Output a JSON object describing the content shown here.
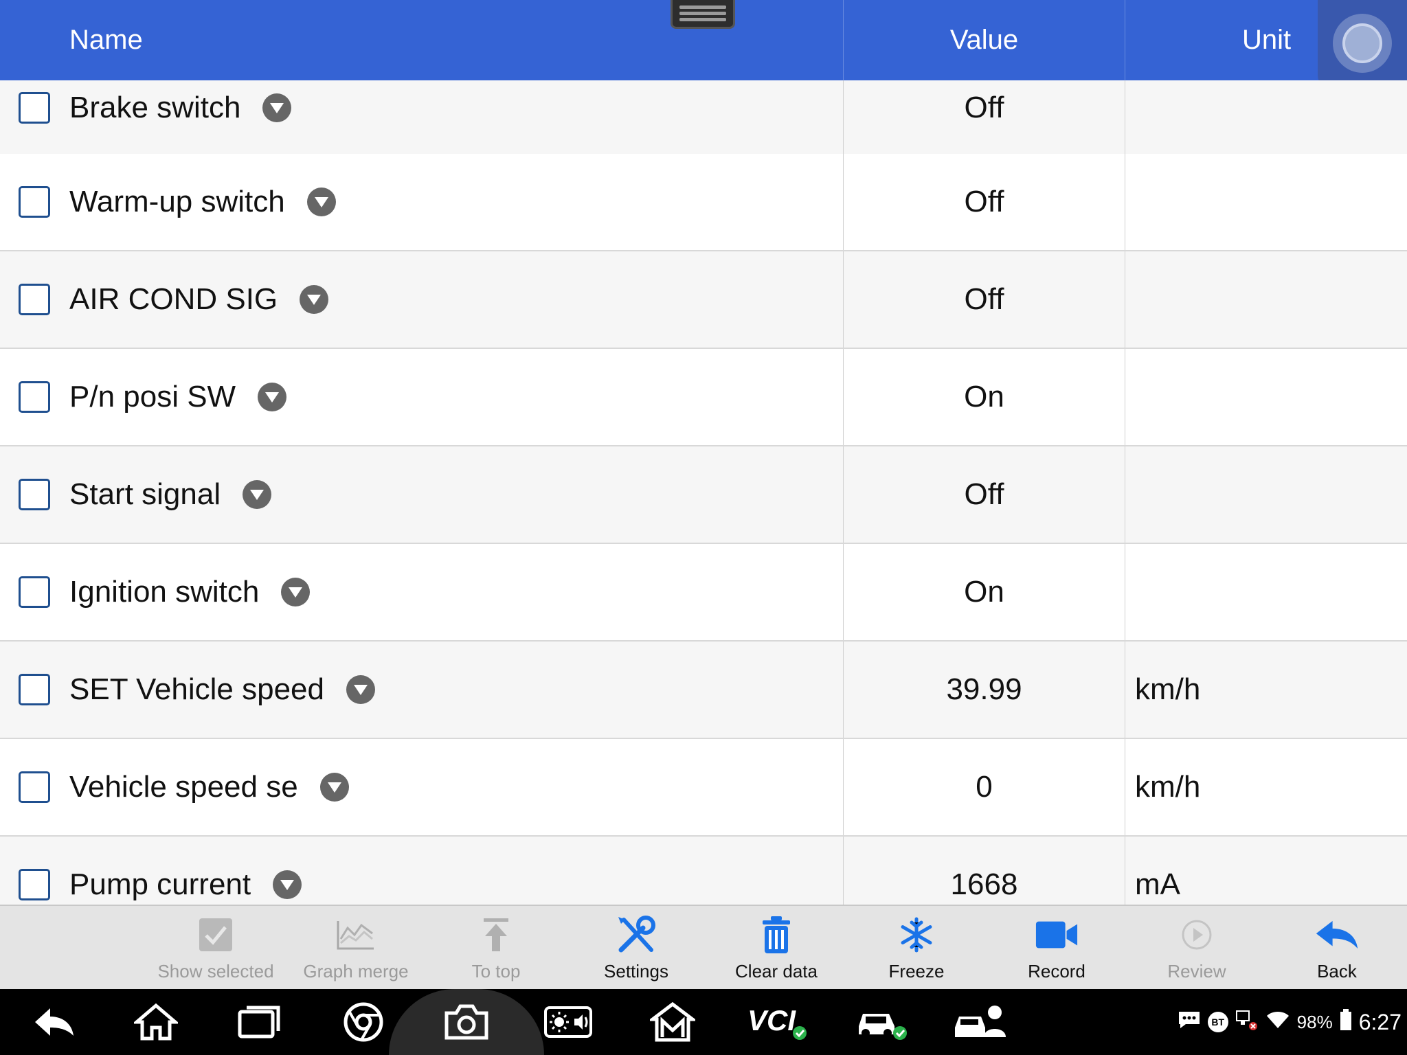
{
  "header": {
    "name_label": "Name",
    "value_label": "Value",
    "unit_label": "Unit"
  },
  "rows": [
    {
      "name": "Brake switch",
      "value": "Off",
      "unit": ""
    },
    {
      "name": "Warm-up switch",
      "value": "Off",
      "unit": ""
    },
    {
      "name": "AIR COND SIG",
      "value": "Off",
      "unit": ""
    },
    {
      "name": "P/n posi SW",
      "value": "On",
      "unit": ""
    },
    {
      "name": "Start signal",
      "value": "Off",
      "unit": ""
    },
    {
      "name": "Ignition switch",
      "value": "On",
      "unit": ""
    },
    {
      "name": "SET Vehicle speed",
      "value": "39.99",
      "unit": "km/h"
    },
    {
      "name": "Vehicle speed se",
      "value": "0",
      "unit": "km/h"
    },
    {
      "name": "Pump current",
      "value": "1668",
      "unit": "mA"
    }
  ],
  "toolbar": {
    "show_selected": "Show selected",
    "graph_merge": "Graph merge",
    "to_top": "To top",
    "settings": "Settings",
    "clear_data": "Clear data",
    "freeze": "Freeze",
    "record": "Record",
    "review": "Review",
    "back": "Back"
  },
  "status_bar": {
    "bt": "BT",
    "battery": "98%",
    "time": "6:27"
  },
  "colors": {
    "header_bg": "#3563d4",
    "accent_blue": "#1a73e8",
    "checkbox_border": "#1f4f8f"
  }
}
